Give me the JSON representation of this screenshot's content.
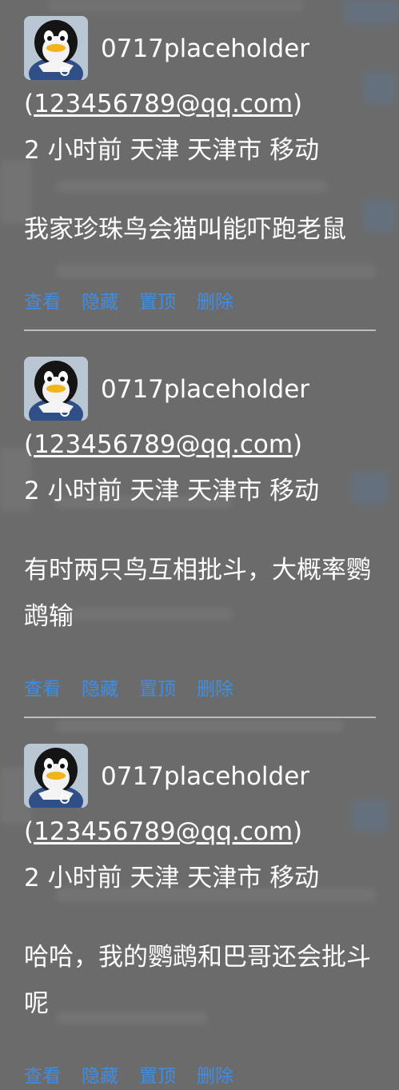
{
  "colors": {
    "overlay_bg": "#6b6b6b",
    "text": "#ffffff",
    "action_link": "#3f8ee6",
    "divider": "#bdbdbd"
  },
  "avatar_icon": "qq-penguin-icon",
  "comments": [
    {
      "username": "0717placeholder",
      "email_open": "(",
      "email": "123456789@qq.com",
      "email_close": ")",
      "time": "2 小时前",
      "province": "天津",
      "city": "天津市",
      "carrier": "移动",
      "text": "我家珍珠鸟会猫叫能吓跑老鼠",
      "actions": {
        "view": "查看",
        "hide": "隐藏",
        "pin": "置顶",
        "delete": "删除"
      }
    },
    {
      "username": "0717placeholder",
      "email_open": "(",
      "email": "123456789@qq.com",
      "email_close": ")",
      "time": "2 小时前",
      "province": "天津",
      "city": "天津市",
      "carrier": "移动",
      "text": "有时两只鸟互相批斗，大概率鹦鹉输",
      "actions": {
        "view": "查看",
        "hide": "隐藏",
        "pin": "置顶",
        "delete": "删除"
      }
    },
    {
      "username": "0717placeholder",
      "email_open": "(",
      "email": "123456789@qq.com",
      "email_close": ")",
      "time": "2 小时前",
      "province": "天津",
      "city": "天津市",
      "carrier": "移动",
      "text": "哈哈，我的鹦鹉和巴哥还会批斗呢",
      "actions": {
        "view": "查看",
        "hide": "隐藏",
        "pin": "置顶",
        "delete": "删除"
      }
    }
  ]
}
